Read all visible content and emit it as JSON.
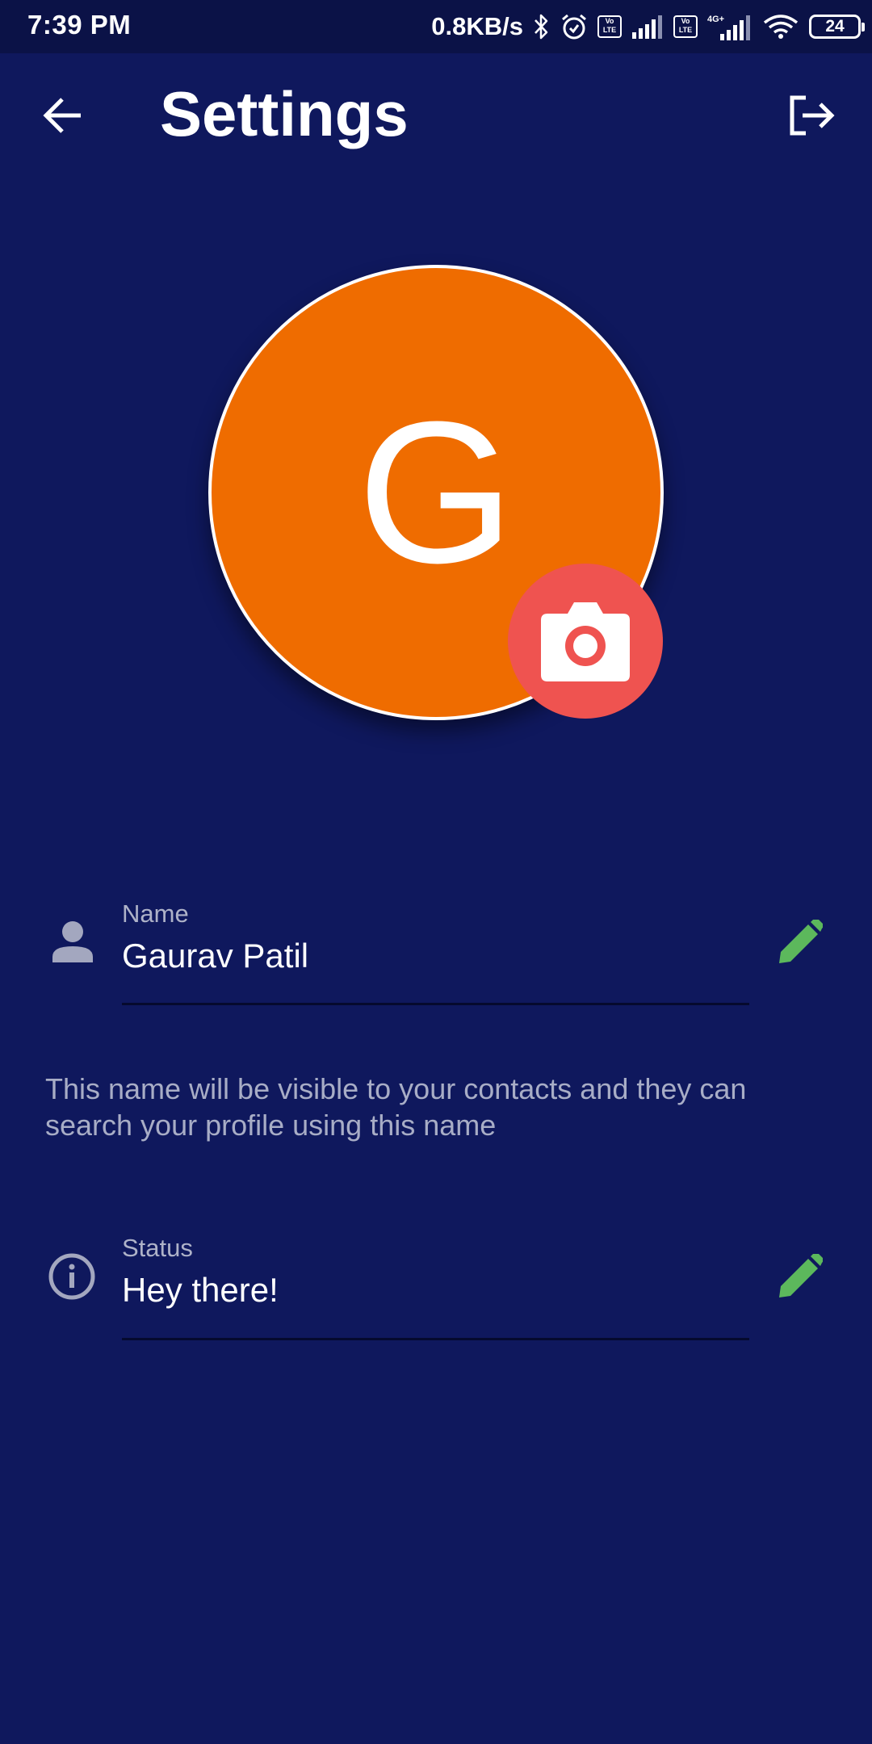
{
  "status_bar": {
    "time": "7:39 PM",
    "network_speed": "0.8KB/s",
    "battery_level": "24",
    "icons": [
      "bluetooth-icon",
      "alarm-icon",
      "volte-icon",
      "signal-icon",
      "4g-icon",
      "wifi-icon",
      "battery-icon"
    ]
  },
  "header": {
    "title": "Settings",
    "back_icon": "arrow-left-icon",
    "logout_icon": "logout-icon"
  },
  "profile": {
    "avatar_initial": "G",
    "avatar_color": "#ef6c00",
    "camera_button_color": "#ef5350",
    "camera_icon": "camera-icon"
  },
  "fields": {
    "name": {
      "label": "Name",
      "value": "Gaurav Patil",
      "icon": "person-icon",
      "helper": "This name will be visible to your contacts and they can search your profile using this name"
    },
    "status": {
      "label": "Status",
      "value": "Hey there!",
      "icon": "info-icon"
    },
    "edit_icon": "pencil-icon",
    "edit_icon_color": "#5cb85c"
  },
  "colors": {
    "background": "#0f185d",
    "status_bar_background": "#0b1247"
  }
}
